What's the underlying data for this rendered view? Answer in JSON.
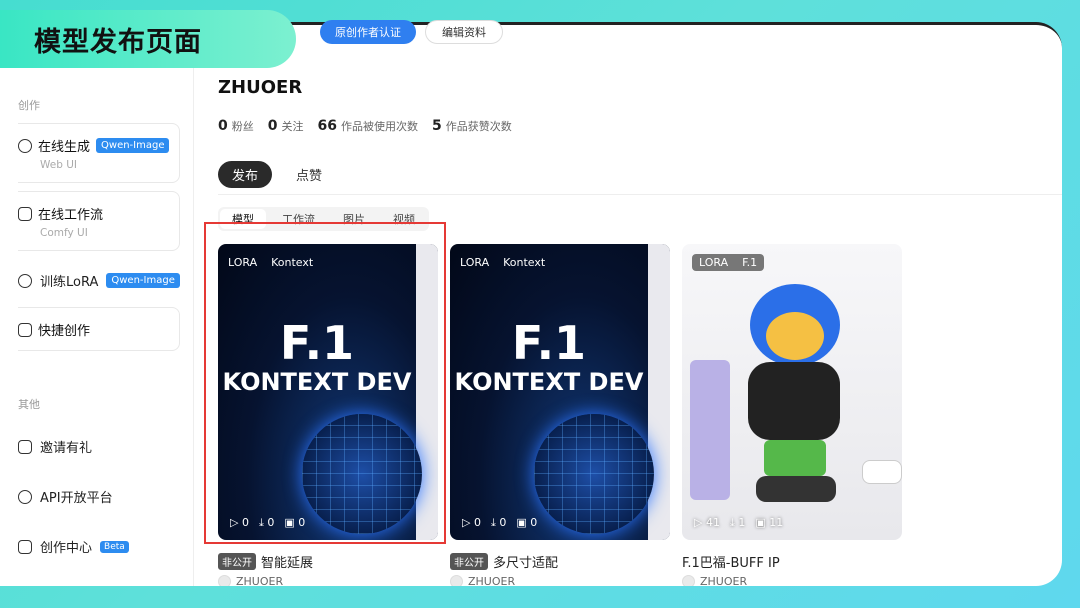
{
  "banner": {
    "title": "模型发布页面"
  },
  "header": {
    "verify_label": "原创作者认证",
    "edit_label": "编辑资料"
  },
  "sidebar": {
    "section_create": "创作",
    "section_other": "其他",
    "items": [
      {
        "label": "在线生成",
        "tag": "Qwen-Image",
        "sub": "Web UI"
      },
      {
        "label": "在线工作流",
        "sub": "Comfy UI"
      },
      {
        "label": "训练LoRA",
        "tag": "Qwen-Image"
      },
      {
        "label": "快捷创作"
      },
      {
        "label": "邀请有礼"
      },
      {
        "label": "API开放平台"
      },
      {
        "label": "创作中心",
        "tag": "Beta"
      }
    ]
  },
  "profile": {
    "name": "ZHUOER",
    "stats": [
      {
        "value": "0",
        "label": "粉丝"
      },
      {
        "value": "0",
        "label": "关注"
      },
      {
        "value": "66",
        "label": "作品被使用次数"
      },
      {
        "value": "5",
        "label": "作品获赞次数"
      }
    ]
  },
  "tabs": [
    "发布",
    "点赞"
  ],
  "subtabs": [
    "模型",
    "工作流",
    "图片",
    "视频"
  ],
  "cards": [
    {
      "tag1": "LORA",
      "tag2": "Kontext",
      "line1": "F.1",
      "line2": "KONTEXT DEV",
      "plays": "0",
      "downloads": "0",
      "images": "0",
      "badge": "非公开",
      "title": "智能延展",
      "author": "ZHUOER"
    },
    {
      "tag1": "LORA",
      "tag2": "Kontext",
      "line1": "F.1",
      "line2": "KONTEXT DEV",
      "plays": "0",
      "downloads": "0",
      "images": "0",
      "badge": "非公开",
      "title": "多尺寸适配",
      "author": "ZHUOER"
    },
    {
      "tag1": "LORA",
      "tag2": "F.1",
      "plays": "41",
      "downloads": "1",
      "images": "11",
      "title": "F.1巴福-BUFF IP",
      "author": "ZHUOER"
    }
  ]
}
